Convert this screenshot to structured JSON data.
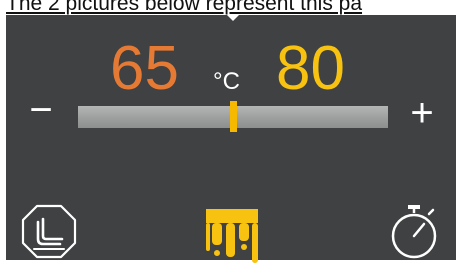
{
  "caption": "The 2 pictures below represent this pa",
  "display": {
    "current_temperature": "65",
    "unit": "°C",
    "target_temperature": "80",
    "minus_label": "−",
    "plus_label": "+"
  },
  "slider": {
    "position_fraction": 0.5
  },
  "icons": {
    "left": "seat-in-octagon-icon",
    "center": "yellow-dripping-icon",
    "right": "stopwatch-icon"
  },
  "colors": {
    "panel": "#3f4142",
    "current_temperature": "#e57a35",
    "target_temperature": "#f7c210",
    "slider_thumb": "#f7b800",
    "icon_accent": "#f7c210",
    "icon_light": "#ffffff"
  }
}
